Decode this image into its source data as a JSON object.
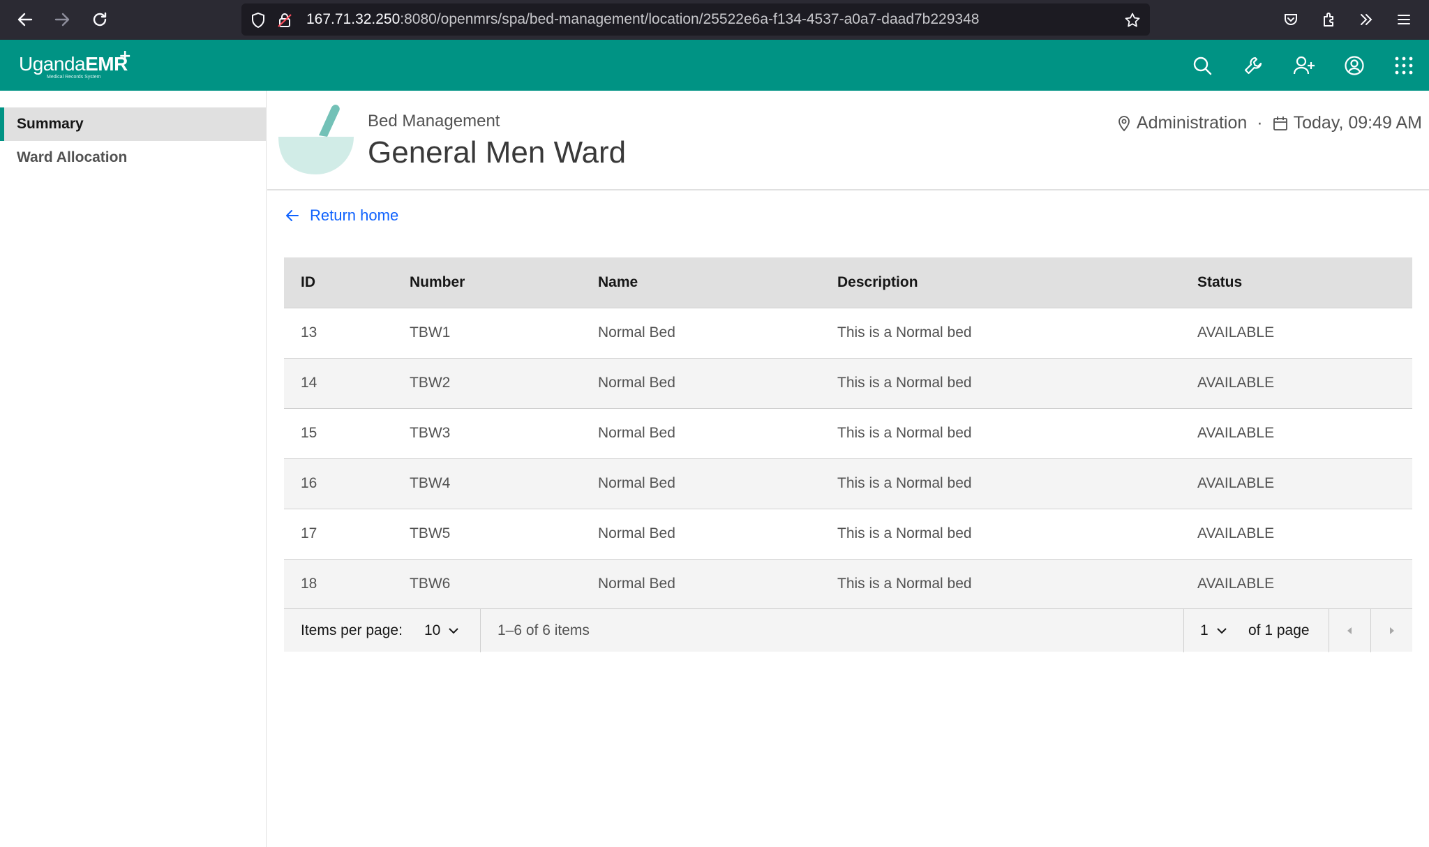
{
  "browser": {
    "url_host": "167.71.32.250",
    "url_rest": ":8080/openmrs/spa/bed-management/location/25522e6a-f134-4537-a0a7-daad7b229348"
  },
  "app": {
    "logo_text_a": "Uganda",
    "logo_text_b": "EMR",
    "logo_plus": "+",
    "logo_tagline": "Medical Records System",
    "header_icons": [
      "search-icon",
      "wrench-icon",
      "add-user-icon",
      "user-avatar-icon",
      "app-switcher-icon"
    ],
    "accent": "#009384"
  },
  "sidebar": {
    "items": [
      {
        "label": "Summary",
        "active": true
      },
      {
        "label": "Ward Allocation",
        "active": false
      }
    ]
  },
  "page_header": {
    "breadcrumb": "Bed Management",
    "title": "General Men Ward",
    "location": "Administration",
    "separator": "·",
    "datetime": "Today, 09:49 AM"
  },
  "return_link": "Return home",
  "table": {
    "columns": [
      "ID",
      "Number",
      "Name",
      "Description",
      "Status"
    ],
    "rows": [
      [
        "13",
        "TBW1",
        "Normal Bed",
        "This is a Normal bed",
        "AVAILABLE"
      ],
      [
        "14",
        "TBW2",
        "Normal Bed",
        "This is a Normal bed",
        "AVAILABLE"
      ],
      [
        "15",
        "TBW3",
        "Normal Bed",
        "This is a Normal bed",
        "AVAILABLE"
      ],
      [
        "16",
        "TBW4",
        "Normal Bed",
        "This is a Normal bed",
        "AVAILABLE"
      ],
      [
        "17",
        "TBW5",
        "Normal Bed",
        "This is a Normal bed",
        "AVAILABLE"
      ],
      [
        "18",
        "TBW6",
        "Normal Bed",
        "This is a Normal bed",
        "AVAILABLE"
      ]
    ]
  },
  "pagination": {
    "items_per_page_label": "Items per page:",
    "items_per_page_value": "10",
    "range_text": "1–6 of 6 items",
    "page_value": "1",
    "page_total_text": "of 1 page"
  }
}
